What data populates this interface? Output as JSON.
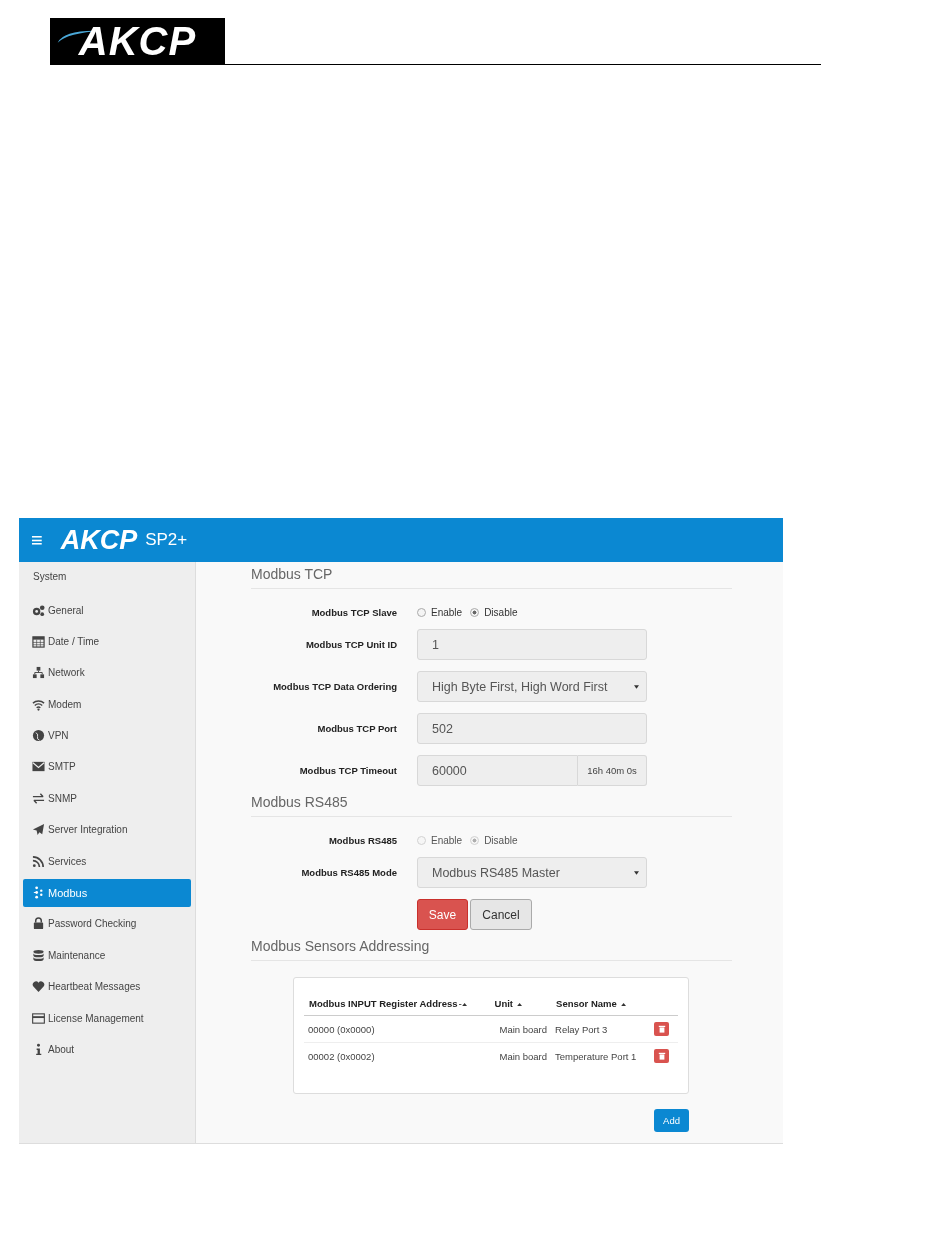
{
  "document_header": {
    "logo": "AKCP"
  },
  "app_bar": {
    "menu": "≡",
    "logo": "AKCP",
    "product": "SP2+"
  },
  "sidebar": {
    "heading": "System",
    "items": [
      {
        "label": "General",
        "selected": false
      },
      {
        "label": "Date / Time",
        "selected": false
      },
      {
        "label": "Network",
        "selected": false
      },
      {
        "label": "Modem",
        "selected": false
      },
      {
        "label": "VPN",
        "selected": false
      },
      {
        "label": "SMTP",
        "selected": false
      },
      {
        "label": "SNMP",
        "selected": false
      },
      {
        "label": "Server Integration",
        "selected": false
      },
      {
        "label": "Services",
        "selected": false
      },
      {
        "label": "Modbus",
        "selected": true
      },
      {
        "label": "Password Checking",
        "selected": false
      },
      {
        "label": "Maintenance",
        "selected": false
      },
      {
        "label": "Heartbeat Messages",
        "selected": false
      },
      {
        "label": "License Management",
        "selected": false
      },
      {
        "label": "About",
        "selected": false
      }
    ]
  },
  "sections": [
    {
      "title": "Modbus TCP",
      "fields": [
        {
          "kind": "radio",
          "label": "Modbus TCP Slave",
          "disabled": false,
          "options": [
            {
              "label": "Enable",
              "selected": false
            },
            {
              "label": "Disable",
              "selected": true
            }
          ]
        },
        {
          "kind": "input",
          "label": "Modbus TCP Unit ID",
          "value": "1"
        },
        {
          "kind": "select",
          "label": "Modbus TCP Data Ordering",
          "value": "High Byte First, High Word First"
        },
        {
          "kind": "input",
          "label": "Modbus TCP Port",
          "value": "502"
        },
        {
          "kind": "addon",
          "label": "Modbus TCP Timeout",
          "value": "60000",
          "addon": "16h 40m 0s"
        }
      ]
    },
    {
      "title": "Modbus RS485",
      "fields": [
        {
          "kind": "radio",
          "label": "Modbus RS485",
          "disabled": true,
          "options": [
            {
              "label": "Enable",
              "selected": false
            },
            {
              "label": "Disable",
              "selected": true
            }
          ]
        },
        {
          "kind": "select",
          "label": "Modbus RS485 Mode",
          "value": "Modbus RS485 Master"
        }
      ],
      "buttons": {
        "save": "Save",
        "cancel": "Cancel"
      }
    }
  ],
  "sensors": {
    "title": "Modbus Sensors Addressing",
    "columns": [
      "Modbus INPUT Register Address",
      "Unit",
      "Sensor Name"
    ],
    "rows": [
      [
        "00000 (0x0000)",
        "Main board",
        "Relay Port 3"
      ],
      [
        "00002 (0x0002)",
        "Main board",
        "Temperature Port 1"
      ]
    ],
    "add": "Add"
  }
}
